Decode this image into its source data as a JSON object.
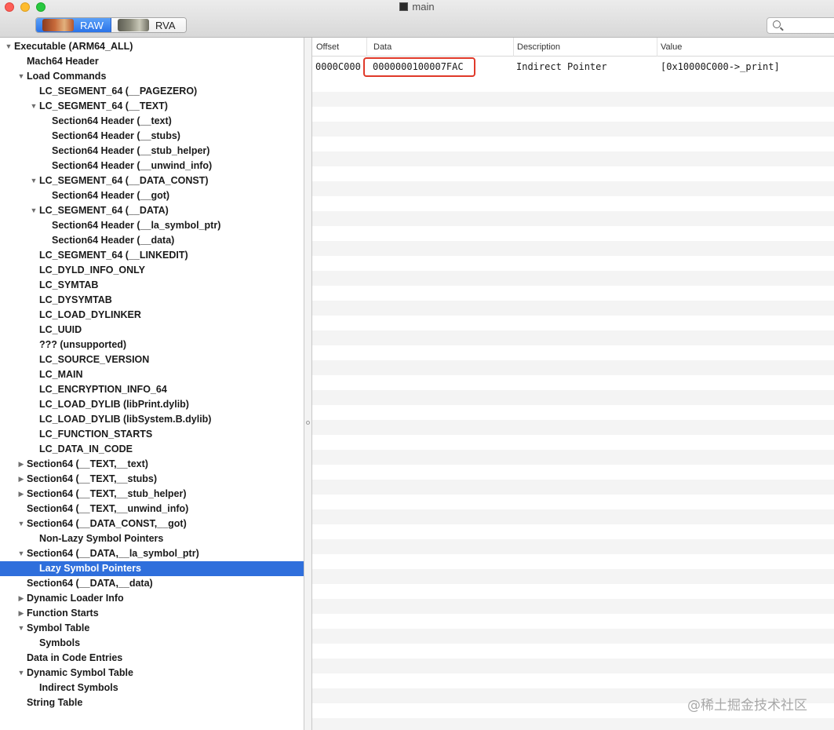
{
  "window": {
    "title": "main"
  },
  "toolbar": {
    "raw_label": "RAW",
    "rva_label": "RVA"
  },
  "sidebar": {
    "items": [
      {
        "label": "Executable  (ARM64_ALL)",
        "indent": 0,
        "disclosure": "open"
      },
      {
        "label": "Mach64 Header",
        "indent": 1,
        "disclosure": "none"
      },
      {
        "label": "Load Commands",
        "indent": 1,
        "disclosure": "open"
      },
      {
        "label": "LC_SEGMENT_64 (__PAGEZERO)",
        "indent": 2,
        "disclosure": "none"
      },
      {
        "label": "LC_SEGMENT_64 (__TEXT)",
        "indent": 2,
        "disclosure": "open"
      },
      {
        "label": "Section64 Header (__text)",
        "indent": 3,
        "disclosure": "none"
      },
      {
        "label": "Section64 Header (__stubs)",
        "indent": 3,
        "disclosure": "none"
      },
      {
        "label": "Section64 Header (__stub_helper)",
        "indent": 3,
        "disclosure": "none"
      },
      {
        "label": "Section64 Header (__unwind_info)",
        "indent": 3,
        "disclosure": "none"
      },
      {
        "label": "LC_SEGMENT_64 (__DATA_CONST)",
        "indent": 2,
        "disclosure": "open"
      },
      {
        "label": "Section64 Header (__got)",
        "indent": 3,
        "disclosure": "none"
      },
      {
        "label": "LC_SEGMENT_64 (__DATA)",
        "indent": 2,
        "disclosure": "open"
      },
      {
        "label": "Section64 Header (__la_symbol_ptr)",
        "indent": 3,
        "disclosure": "none"
      },
      {
        "label": "Section64 Header (__data)",
        "indent": 3,
        "disclosure": "none"
      },
      {
        "label": "LC_SEGMENT_64 (__LINKEDIT)",
        "indent": 2,
        "disclosure": "none"
      },
      {
        "label": "LC_DYLD_INFO_ONLY",
        "indent": 2,
        "disclosure": "none"
      },
      {
        "label": "LC_SYMTAB",
        "indent": 2,
        "disclosure": "none"
      },
      {
        "label": "LC_DYSYMTAB",
        "indent": 2,
        "disclosure": "none"
      },
      {
        "label": "LC_LOAD_DYLINKER",
        "indent": 2,
        "disclosure": "none"
      },
      {
        "label": "LC_UUID",
        "indent": 2,
        "disclosure": "none"
      },
      {
        "label": "??? (unsupported)",
        "indent": 2,
        "disclosure": "none"
      },
      {
        "label": "LC_SOURCE_VERSION",
        "indent": 2,
        "disclosure": "none"
      },
      {
        "label": "LC_MAIN",
        "indent": 2,
        "disclosure": "none"
      },
      {
        "label": "LC_ENCRYPTION_INFO_64",
        "indent": 2,
        "disclosure": "none"
      },
      {
        "label": "LC_LOAD_DYLIB (libPrint.dylib)",
        "indent": 2,
        "disclosure": "none"
      },
      {
        "label": "LC_LOAD_DYLIB (libSystem.B.dylib)",
        "indent": 2,
        "disclosure": "none"
      },
      {
        "label": "LC_FUNCTION_STARTS",
        "indent": 2,
        "disclosure": "none"
      },
      {
        "label": "LC_DATA_IN_CODE",
        "indent": 2,
        "disclosure": "none"
      },
      {
        "label": "Section64 (__TEXT,__text)",
        "indent": 1,
        "disclosure": "closed"
      },
      {
        "label": "Section64 (__TEXT,__stubs)",
        "indent": 1,
        "disclosure": "closed"
      },
      {
        "label": "Section64 (__TEXT,__stub_helper)",
        "indent": 1,
        "disclosure": "closed"
      },
      {
        "label": "Section64 (__TEXT,__unwind_info)",
        "indent": 1,
        "disclosure": "none"
      },
      {
        "label": "Section64 (__DATA_CONST,__got)",
        "indent": 1,
        "disclosure": "open"
      },
      {
        "label": "Non-Lazy Symbol Pointers",
        "indent": 2,
        "disclosure": "none"
      },
      {
        "label": "Section64 (__DATA,__la_symbol_ptr)",
        "indent": 1,
        "disclosure": "open"
      },
      {
        "label": "Lazy Symbol Pointers",
        "indent": 2,
        "disclosure": "none",
        "selected": true
      },
      {
        "label": "Section64 (__DATA,__data)",
        "indent": 1,
        "disclosure": "none"
      },
      {
        "label": "Dynamic Loader Info",
        "indent": 1,
        "disclosure": "closed"
      },
      {
        "label": "Function Starts",
        "indent": 1,
        "disclosure": "closed"
      },
      {
        "label": "Symbol Table",
        "indent": 1,
        "disclosure": "open"
      },
      {
        "label": "Symbols",
        "indent": 2,
        "disclosure": "none"
      },
      {
        "label": "Data in Code Entries",
        "indent": 1,
        "disclosure": "none"
      },
      {
        "label": "Dynamic Symbol Table",
        "indent": 1,
        "disclosure": "open"
      },
      {
        "label": "Indirect Symbols",
        "indent": 2,
        "disclosure": "none"
      },
      {
        "label": "String Table",
        "indent": 1,
        "disclosure": "none"
      }
    ]
  },
  "table": {
    "columns": {
      "offset": "Offset",
      "data": "Data",
      "description": "Description",
      "value": "Value"
    },
    "rows": [
      {
        "offset": "0000C000",
        "data": "0000000100007FAC",
        "description": "Indirect Pointer",
        "value": "[0x10000C000->_print]"
      }
    ]
  },
  "watermark": "@稀土掘金技术社区",
  "colors": {
    "selection": "#2f6fdc",
    "highlight_box": "#e03a2a",
    "stripe": "#f4f4f4"
  }
}
